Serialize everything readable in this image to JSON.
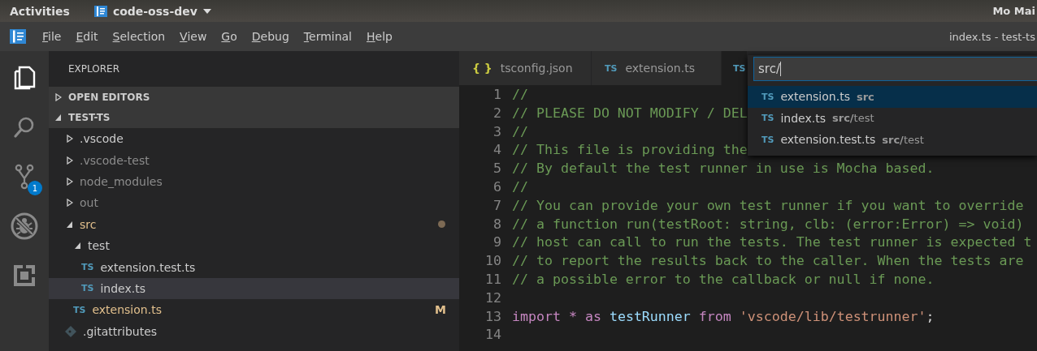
{
  "top_bar": {
    "activities": "Activities",
    "app_name": "code-oss-dev",
    "user": "Mo Mai"
  },
  "menu_bar": {
    "items": [
      "File",
      "Edit",
      "Selection",
      "View",
      "Go",
      "Debug",
      "Terminal",
      "Help"
    ],
    "title": "index.ts - test-ts"
  },
  "activity_bar": [
    {
      "kind": "files",
      "selected": true
    },
    {
      "kind": "search",
      "selected": false
    },
    {
      "kind": "scm",
      "selected": false,
      "badge": "1"
    },
    {
      "kind": "debug",
      "selected": false
    },
    {
      "kind": "extensions",
      "selected": false
    }
  ],
  "sidebar": {
    "title": "EXPLORER",
    "sections": [
      {
        "label": "OPEN EDITORS",
        "expanded": false
      },
      {
        "label": "TEST-TS",
        "expanded": true
      }
    ],
    "tree": [
      {
        "name": ".vscode",
        "kind": "folder",
        "expanded": false,
        "ignored": false,
        "modified": false,
        "selected": false
      },
      {
        "name": ".vscode-test",
        "kind": "folder",
        "expanded": false,
        "ignored": true,
        "modified": false,
        "selected": false
      },
      {
        "name": "node_modules",
        "kind": "folder",
        "expanded": false,
        "ignored": true,
        "modified": false,
        "selected": false
      },
      {
        "name": "out",
        "kind": "folder",
        "expanded": false,
        "ignored": true,
        "modified": false,
        "selected": false
      },
      {
        "name": "src",
        "kind": "folder",
        "expanded": true,
        "ignored": false,
        "modified": true,
        "dirty_dot": true,
        "selected": false,
        "children": [
          {
            "name": "test",
            "kind": "folder",
            "expanded": true,
            "ignored": false,
            "modified": false,
            "selected": false,
            "children": [
              {
                "name": "extension.test.ts",
                "kind": "ts",
                "icon": "TS",
                "ignored": false,
                "modified": false,
                "selected": false
              },
              {
                "name": "index.ts",
                "kind": "ts",
                "icon": "TS",
                "ignored": false,
                "modified": false,
                "selected": true
              }
            ]
          },
          {
            "name": "extension.ts",
            "kind": "ts",
            "icon": "TS",
            "ignored": false,
            "modified": true,
            "flag": "M",
            "selected": false
          }
        ]
      },
      {
        "name": ".gitattributes",
        "kind": "git",
        "ignored": false,
        "modified": false,
        "selected": false
      }
    ]
  },
  "tabs": [
    {
      "icon": "{ }",
      "kind": "json",
      "label": "tsconfig.json",
      "selected": false
    },
    {
      "icon": "TS",
      "kind": "ts",
      "label": "extension.ts",
      "selected": false
    },
    {
      "icon": "TS",
      "kind": "ts",
      "selected": true
    }
  ],
  "editor": {
    "lines": [
      {
        "number": "1",
        "tokens": [
          {
            "text": "//",
            "kind": "comment"
          }
        ]
      },
      {
        "number": "2",
        "tokens": [
          {
            "text": "// PLEASE DO NOT MODIFY / DEL",
            "kind": "comment"
          }
        ]
      },
      {
        "number": "3",
        "tokens": [
          {
            "text": "//",
            "kind": "comment"
          }
        ]
      },
      {
        "number": "4",
        "tokens": [
          {
            "text": "// This file is providing the",
            "kind": "comment"
          }
        ]
      },
      {
        "number": "5",
        "tokens": [
          {
            "text": "// By default the test runner in use is Mocha based.",
            "kind": "comment"
          }
        ]
      },
      {
        "number": "6",
        "tokens": [
          {
            "text": "//",
            "kind": "comment"
          }
        ]
      },
      {
        "number": "7",
        "tokens": [
          {
            "text": "// You can provide your own test runner if you want to override",
            "kind": "comment"
          }
        ]
      },
      {
        "number": "8",
        "tokens": [
          {
            "text": "// a function run(testRoot: string, clb: (error:Error) => void)",
            "kind": "comment"
          }
        ]
      },
      {
        "number": "9",
        "tokens": [
          {
            "text": "// host can call to run the tests. The test runner is expected t",
            "kind": "comment"
          }
        ]
      },
      {
        "number": "10",
        "tokens": [
          {
            "text": "// to report the results back to the caller. When the tests are",
            "kind": "comment"
          }
        ]
      },
      {
        "number": "11",
        "tokens": [
          {
            "text": "// a possible error to the callback or null if none.",
            "kind": "comment"
          }
        ]
      },
      {
        "number": "12"
      },
      {
        "number": "13",
        "tokens": [
          {
            "text": "import ",
            "kind": "keyword"
          },
          {
            "text": "* ",
            "kind": "operator"
          },
          {
            "text": "as ",
            "kind": "keyword"
          },
          {
            "text": "testRunner ",
            "kind": "variable"
          },
          {
            "text": "from ",
            "kind": "keyword"
          },
          {
            "text": "'vscode/lib/testrunner'",
            "kind": "string"
          },
          {
            "text": ";",
            "kind": "plain"
          }
        ]
      },
      {
        "number": "14"
      }
    ]
  },
  "quick_open": {
    "value": "src/",
    "results": [
      {
        "icon": "TS",
        "label": "extension.ts",
        "path": "**src**",
        "selected": true
      },
      {
        "icon": "TS",
        "label": "index.ts",
        "path": "**src/**test",
        "selected": false
      },
      {
        "icon": "TS",
        "label": "extension.test.ts",
        "path": "**src/**test",
        "selected": false
      }
    ]
  }
}
